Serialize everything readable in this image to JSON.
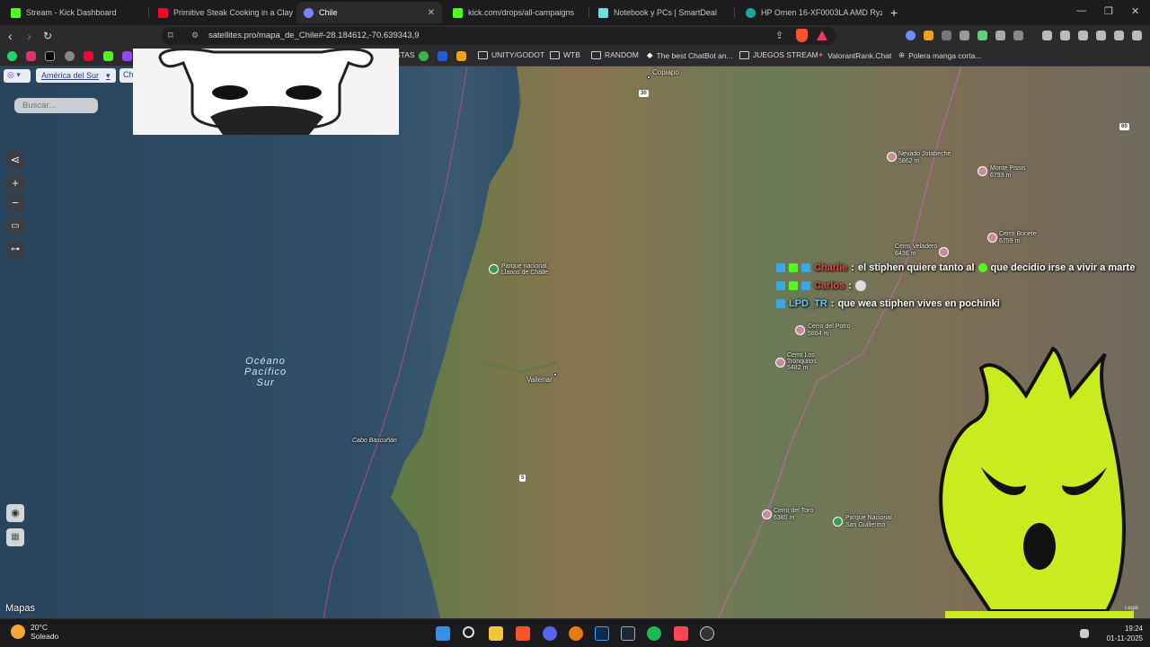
{
  "tabs": [
    {
      "title": "Stream - Kick Dashboard",
      "color": "#53fc18"
    },
    {
      "title": "Primitive Steak Cooking in a Clay Ov...",
      "color": "#ff0033"
    },
    {
      "title": "Chile",
      "color": "#7a86ff",
      "active": true
    },
    {
      "title": "kick.com/drops/all-campaigns",
      "color": "#53fc18"
    },
    {
      "title": "Notebook y PCs | SmartDeal",
      "color": "#6fe0d8"
    },
    {
      "title": "HP Omen 16-XF0003LA AMD Ryzen...",
      "color": "#1aa89a"
    }
  ],
  "address": {
    "url": "satellites.pro/mapa_de_Chile#-28.184612,-70.639343,9"
  },
  "bookmarks": {
    "items": [
      "STAS",
      "UNITY/GODOT",
      "WTB",
      "RANDOM",
      "The best ChatBot an...",
      "JUEGOS STREAM",
      "ValorantRank.Chat",
      "Polera manga corta..."
    ]
  },
  "map": {
    "region": "América del Sur",
    "region2": "Ch",
    "search_placeholder": "Buscar...",
    "brand": "Mapas",
    "legal": "Legal",
    "ocean_label": [
      "Océano",
      "Pacífico",
      "Sur"
    ],
    "places": {
      "copiapo": "Copiapó",
      "vallenar": "Vallenar",
      "cabo": "Cabo Bascuñán",
      "llanos": [
        "Parque nacional",
        "Llanos de Challe"
      ],
      "ojos": [
        "Nevado Jotabeche",
        "5862 m"
      ],
      "pissis": [
        "Monte Pissis",
        "6793 m"
      ],
      "bonete": [
        "Cerro Bonete",
        "6759 m"
      ],
      "veladero": [
        "Cerro Veladero",
        "6436 m"
      ],
      "potro": [
        "Cerro del Potro",
        "5864 m"
      ],
      "tronquitos": [
        "Cerro Los",
        "Tronquitos",
        "5482 m"
      ],
      "toro": [
        "Cerro del Toro",
        "6380 m"
      ],
      "sanguillermo": [
        "Parque Nacional",
        "San Guillermo"
      ]
    },
    "route_numbers": [
      "30",
      "5",
      "60"
    ]
  },
  "chat": [
    {
      "user": "Charlie",
      "sep": ":",
      "msg": "el stiphen quiere tanto al",
      "msg2": "que decidio irse a vivir a marte"
    },
    {
      "user": "Carlos",
      "sep": ":",
      "msg": ""
    },
    {
      "user": "LPD_TR",
      "sep": ":",
      "msg": "que wea stiphen vives en pochinki"
    }
  ],
  "taskbar": {
    "temp": "20°C",
    "weather": "Soleado",
    "time": "19:24",
    "date": "01-11-2025"
  },
  "colors": {
    "accent": "#53fc18",
    "mascot": "#c8ec1f"
  }
}
